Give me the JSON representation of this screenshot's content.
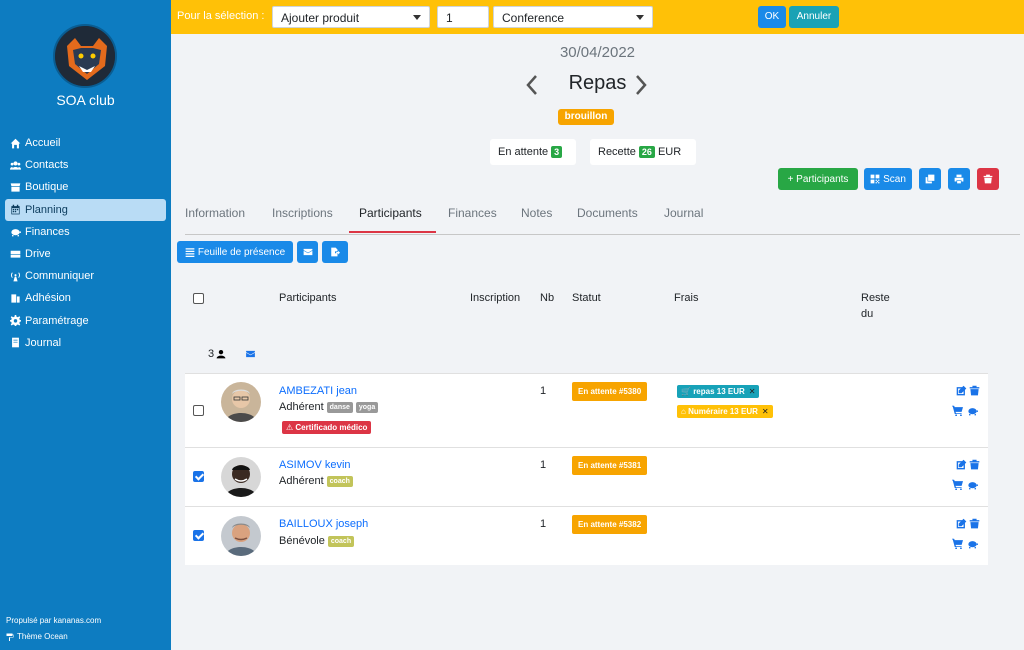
{
  "sidebar": {
    "club_name": "SOA club",
    "menu": [
      {
        "label": "Accueil",
        "icon": "home-icon"
      },
      {
        "label": "Contacts",
        "icon": "users-icon"
      },
      {
        "label": "Boutique",
        "icon": "store-icon"
      },
      {
        "label": "Planning",
        "icon": "calendar-icon"
      },
      {
        "label": "Finances",
        "icon": "piggy-bank-icon"
      },
      {
        "label": "Drive",
        "icon": "drive-icon"
      },
      {
        "label": "Communiquer",
        "icon": "broadcast-icon"
      },
      {
        "label": "Adhésion",
        "icon": "id-card-icon"
      },
      {
        "label": "Paramétrage",
        "icon": "gear-icon"
      },
      {
        "label": "Journal",
        "icon": "book-icon"
      }
    ],
    "active_item": "Planning",
    "powered_by": "Propulsé par kananas.com",
    "theme": "Thème Ocean"
  },
  "topbar": {
    "label": "Pour la sélection :",
    "action_select": "Ajouter produit",
    "quantity": "1",
    "product_select": "Conference",
    "ok": "OK",
    "cancel": "Annuler"
  },
  "header": {
    "date": "30/04/2022",
    "title": "Repas",
    "status_badge": "brouillon",
    "pending_label": "En attente",
    "pending_count": "3",
    "revenue_label": "Recette",
    "revenue_value": "26",
    "revenue_currency": "EUR"
  },
  "actions": {
    "add_participants": "+ Participants",
    "scan": "Scan"
  },
  "tabs": [
    "Information",
    "Inscriptions",
    "Participants",
    "Finances",
    "Notes",
    "Documents",
    "Journal"
  ],
  "active_tab": "Participants",
  "subactions": {
    "attendance_sheet": "Feuille de présence"
  },
  "table": {
    "headers": {
      "participants": "Participants",
      "inscription": "Inscription",
      "nb": "Nb",
      "statut": "Statut",
      "frais": "Frais",
      "reste_line1": "Reste",
      "reste_line2": "du"
    },
    "summary_count": "3",
    "rows": [
      {
        "name": "AMBEZATI jean",
        "role": "Adhérent",
        "tags": [
          "danse",
          "yoga"
        ],
        "alert": "Certificado médico",
        "nb": "1",
        "status": "En attente #5380",
        "fees": [
          {
            "label": "repas 13 EUR",
            "color": "#17a2b8"
          },
          {
            "label": "Numéraire 13 EUR",
            "color": "#ffc107"
          }
        ],
        "checked": false
      },
      {
        "name": "ASIMOV kevin",
        "role": "Adhérent",
        "tags": [
          "coach"
        ],
        "nb": "1",
        "status": "En attente #5381",
        "checked": true
      },
      {
        "name": "BAILLOUX joseph",
        "role": "Bénévole",
        "tags": [
          "coach"
        ],
        "nb": "1",
        "status": "En attente #5382",
        "checked": true
      }
    ]
  },
  "colors": {
    "sidebar_bg": "#0d7cc1",
    "topbar_bg": "#ffc107",
    "primary": "#1a8ae8",
    "success": "#28a745",
    "danger": "#dc3545",
    "warning": "#f7a400"
  }
}
